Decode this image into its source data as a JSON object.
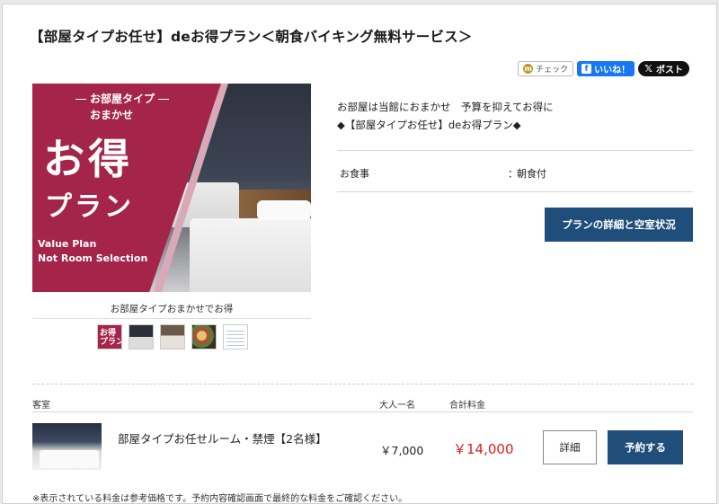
{
  "plan": {
    "title": "【部屋タイプお任せ】deお得プラン＜朝食バイキング無料サービス＞",
    "image": {
      "line1": "お部屋タイプ",
      "line2": "おまかせ",
      "big1": "お得",
      "big2": "プラン",
      "en1": "Value Plan",
      "en2": "Not Room Selection"
    },
    "caption": "お部屋タイプおまかせでお得",
    "description_line1": "お部屋は当館におまかせ　予算を抑えてお得に",
    "description_line2": "◆【部屋タイプお任せ】deお得プラン◆",
    "meal_label": "お食事",
    "meal_colon": "：",
    "meal_value": "朝食付",
    "detail_button": "プランの詳細と空室状況",
    "thumb1_text": "お得\nプラン"
  },
  "share": {
    "check_icon": "m",
    "check_label": "チェック",
    "like_icon": "f",
    "like_label": "いいね！",
    "x_icon": "𝕏",
    "x_label": "ポスト"
  },
  "table": {
    "headers": {
      "room": "客室",
      "per_adult": "大人一名",
      "total": "合計料金"
    },
    "rows": [
      {
        "room_name": "部屋タイプお任せルーム・禁煙【2名様】",
        "per_adult_price": "￥7,000",
        "total_price": "￥14,000",
        "detail_label": "詳細",
        "book_label": "予約する"
      }
    ]
  },
  "note": "※表示されている料金は参考価格です。予約内容確認画面で最終的な料金をご確認ください。",
  "colors": {
    "accent": "#1f4e7a",
    "brand": "#a4244a",
    "price": "#e21b1b"
  }
}
